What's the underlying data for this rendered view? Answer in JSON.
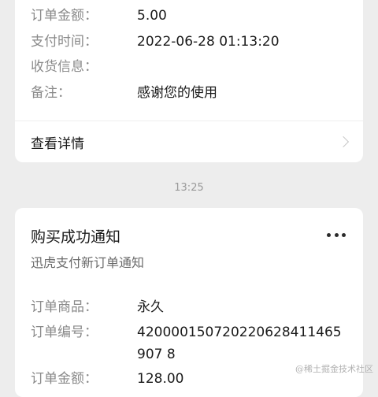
{
  "card1": {
    "rows": [
      {
        "label": "订单金额：",
        "value": "5.00"
      },
      {
        "label": "支付时间：",
        "value": "2022-06-28 01:13:20"
      },
      {
        "label": "收货信息：",
        "value": ""
      },
      {
        "label": "备注：",
        "value": "感谢您的使用"
      }
    ],
    "details_label": "查看详情"
  },
  "time_separator": "13:25",
  "card2": {
    "title": "购买成功通知",
    "subtitle": "迅虎支付新订单通知",
    "rows": [
      {
        "label": "订单商品：",
        "value": "永久"
      },
      {
        "label": "订单编号：",
        "value": "420000150720220628411465907 8"
      },
      {
        "label": "订单金额：",
        "value": "128.00"
      }
    ]
  },
  "watermark": "@稀土掘金技术社区",
  "icons": {
    "more": "more-horizontal-icon",
    "chevron": "chevron-right-icon"
  }
}
